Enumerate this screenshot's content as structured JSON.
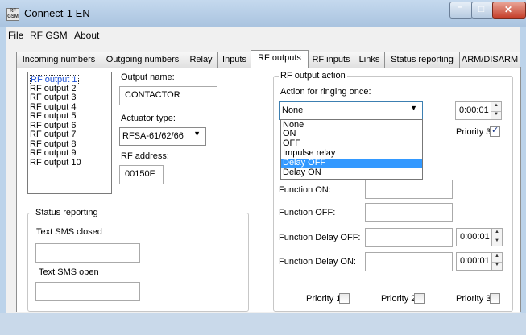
{
  "window": {
    "title": "Connect-1 EN",
    "icon_text": "RF\nGSM",
    "min_label": "–",
    "max_label": "□",
    "close_label": "✕"
  },
  "menu": [
    "File",
    "RF GSM",
    "About"
  ],
  "tabs": [
    "Incoming numbers",
    "Outgoing numbers",
    "Relay",
    "Inputs",
    "RF outputs",
    "RF inputs",
    "Links",
    "Status reporting",
    "ARM/DISARM"
  ],
  "active_tab": "RF outputs",
  "outputs_list": [
    "RF output 1",
    "RF output 2",
    "RF output 3",
    "RF output 4",
    "RF output 5",
    "RF output 6",
    "RF output 7",
    "RF output 8",
    "RF output 9",
    "RF output 10"
  ],
  "selected_output": "RF output 1",
  "output_name_label": "Output name:",
  "output_name_value": "CONTACTOR",
  "actuator_label": "Actuator type:",
  "actuator_value": "RFSA-61/62/66",
  "rf_address_label": "RF address:",
  "rf_address_value": "00150F",
  "status_group": {
    "title": "Status reporting",
    "closed_label": "Text SMS closed",
    "closed_value": "",
    "open_label": "Text SMS open",
    "open_value": ""
  },
  "action_group": {
    "title": "RF output action",
    "ringing_label": "Action for ringing once:",
    "ringing_value": "None",
    "ringing_time": "0:00:01",
    "ringing_options": [
      "None",
      "ON",
      "OFF",
      "Impulse relay",
      "Delay OFF",
      "Delay ON"
    ],
    "highlighted_option": "Delay OFF",
    "priority3_top": {
      "label": "Priority 3",
      "checked": true
    },
    "function_on_label": "Function ON:",
    "function_on_value": "",
    "function_off_label": "Function OFF:",
    "function_off_value": "",
    "function_delay_off_label": "Function Delay OFF:",
    "function_delay_off_value": "",
    "function_delay_off_time": "0:00:01",
    "function_delay_on_label": "Function Delay ON:",
    "function_delay_on_value": "",
    "function_delay_on_time": "0:00:01",
    "priorities": [
      {
        "label": "Priority 1",
        "checked": false
      },
      {
        "label": "Priority 2",
        "checked": false
      },
      {
        "label": "Priority 3",
        "checked": false
      }
    ]
  },
  "spin_up_glyph": "▲",
  "spin_down_glyph": "▼",
  "combo_arrow_glyph": "▼",
  "check_glyph": "✓"
}
